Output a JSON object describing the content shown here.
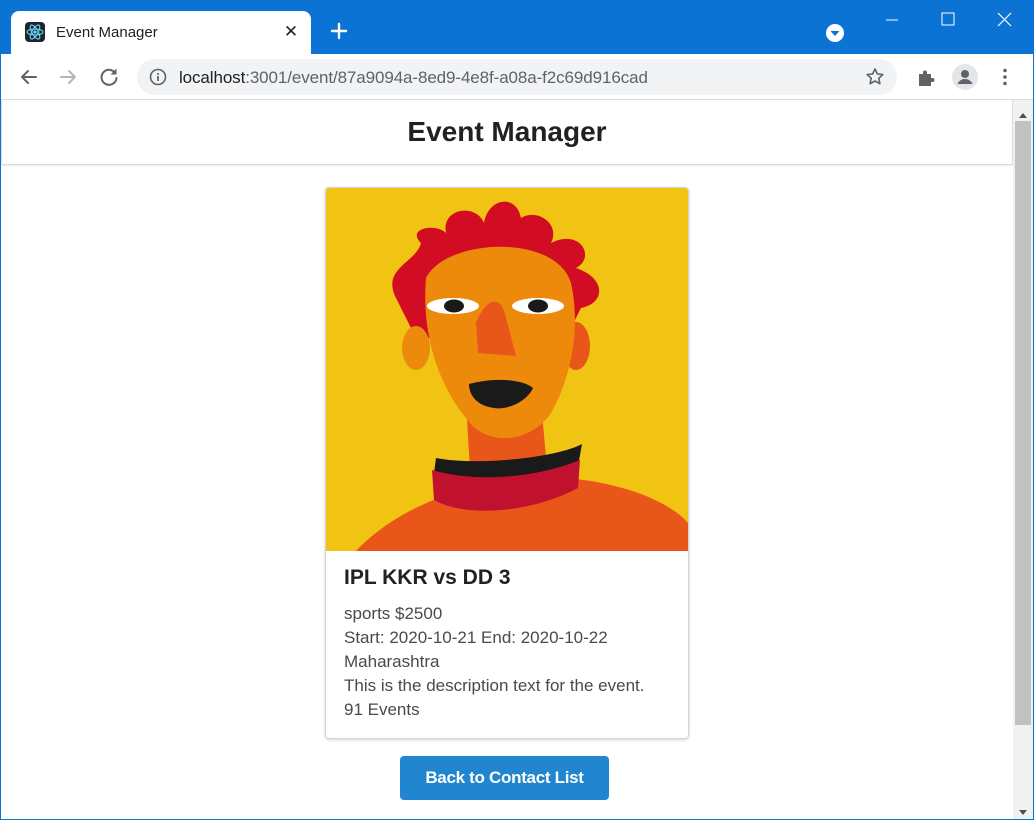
{
  "browser": {
    "tab_title": "Event Manager",
    "tab_close_label": "✕",
    "url_host": "localhost",
    "url_path": ":3001/event/87a9094a-8ed9-4e8f-a08a-f2c69d916cad",
    "accent_color": "#0b73d3"
  },
  "app": {
    "title": "Event Manager"
  },
  "event": {
    "name": "IPL KKR vs DD 3",
    "category_price": "sports $2500",
    "dates": "Start: 2020-10-21 End: 2020-10-22",
    "location": "Maharashtra",
    "description": "This is the description text for the event.",
    "events_count": "91 Events"
  },
  "actions": {
    "back_label": "Back to Contact List",
    "button_color": "#2185d0"
  },
  "icons": {
    "favicon": "react-atom-icon",
    "new_tab": "plus-icon",
    "back": "arrow-left-icon",
    "forward": "arrow-right-icon",
    "reload": "reload-icon",
    "info": "info-icon",
    "bookmark": "star-icon",
    "extensions": "puzzle-icon",
    "profile": "person-icon",
    "menu": "kebab-menu-icon"
  }
}
